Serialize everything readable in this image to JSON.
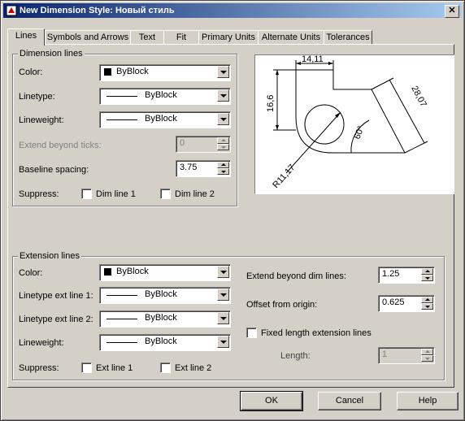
{
  "window": {
    "title": "New Dimension Style: Новый стиль",
    "close_label": "✕"
  },
  "tabs": [
    {
      "label": "Lines"
    },
    {
      "label": "Symbols and Arrows"
    },
    {
      "label": "Text"
    },
    {
      "label": "Fit"
    },
    {
      "label": "Primary Units"
    },
    {
      "label": "Alternate Units"
    },
    {
      "label": "Tolerances"
    }
  ],
  "dimension_lines": {
    "legend": "Dimension lines",
    "color_label": "Color:",
    "color_value": "ByBlock",
    "linetype_label": "Linetype:",
    "linetype_value": "ByBlock",
    "lineweight_label": "Lineweight:",
    "lineweight_value": "ByBlock",
    "extend_label": "Extend beyond ticks:",
    "extend_value": "0",
    "baseline_label": "Baseline spacing:",
    "baseline_value": "3.75",
    "suppress_label": "Suppress:",
    "dim_line1": "Dim line 1",
    "dim_line2": "Dim line 2"
  },
  "extension_lines": {
    "legend": "Extension lines",
    "color_label": "Color:",
    "color_value": "ByBlock",
    "linetype1_label": "Linetype ext line 1:",
    "linetype1_value": "ByBlock",
    "linetype2_label": "Linetype ext line 2:",
    "linetype2_value": "ByBlock",
    "lineweight_label": "Lineweight:",
    "lineweight_value": "ByBlock",
    "suppress_label": "Suppress:",
    "ext_line1": "Ext line 1",
    "ext_line2": "Ext line 2",
    "extend_beyond_label": "Extend beyond dim lines:",
    "extend_beyond_value": "1.25",
    "offset_label": "Offset from origin:",
    "offset_value": "0.625",
    "fixed_length_label": "Fixed length extension lines",
    "length_label": "Length:",
    "length_value": "1"
  },
  "preview": {
    "dim_top": "14,11",
    "dim_left": "16,6",
    "dim_right": "28,07",
    "dim_angle": "60°",
    "dim_radius": "R11,17"
  },
  "buttons": {
    "ok": "OK",
    "cancel": "Cancel",
    "help": "Help"
  }
}
